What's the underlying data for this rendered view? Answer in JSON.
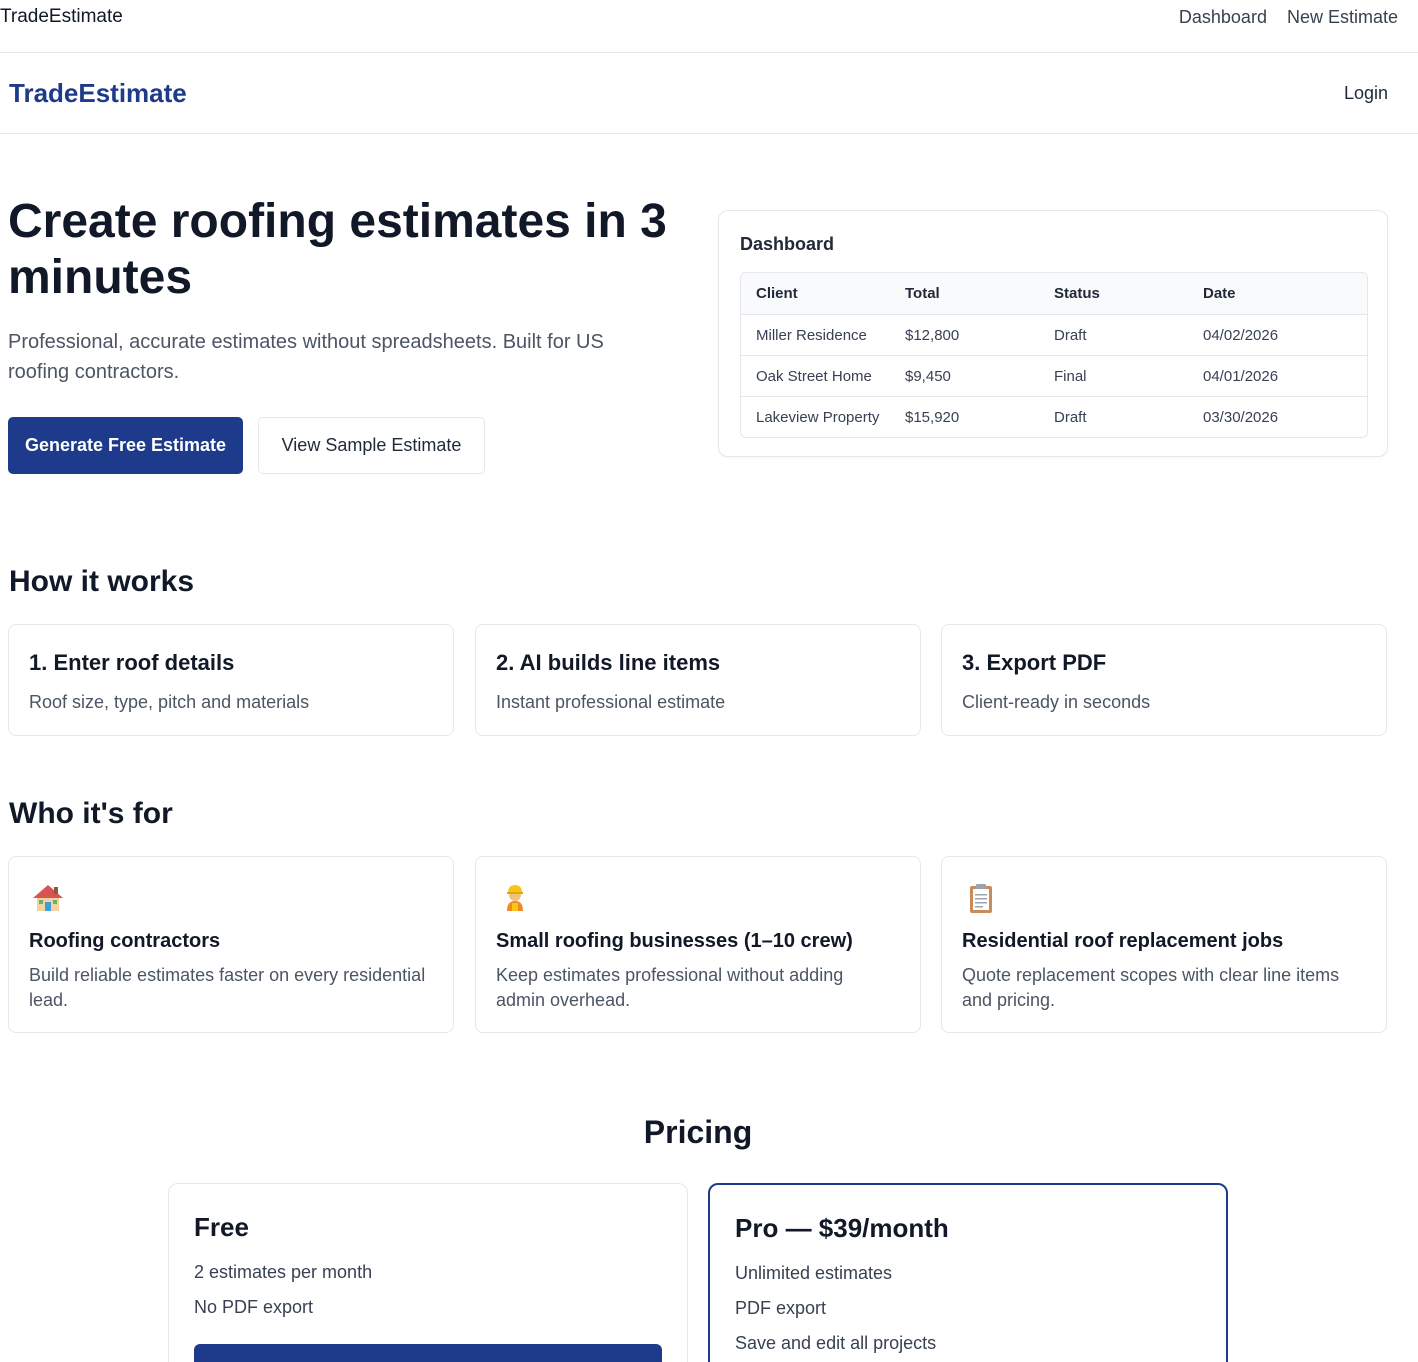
{
  "appbar": {
    "brand": "TradeEstimate",
    "nav": [
      "Dashboard",
      "New Estimate"
    ]
  },
  "header": {
    "logo": "TradeEstimate",
    "login": "Login"
  },
  "hero": {
    "title": "Create roofing estimates in 3 minutes",
    "subtitle": "Professional, accurate estimates without spreadsheets. Built for US roofing contractors.",
    "primary_button": "Generate Free Estimate",
    "secondary_button": "View Sample Estimate"
  },
  "dashboard_preview": {
    "title": "Dashboard",
    "columns": [
      "Client",
      "Total",
      "Status",
      "Date"
    ],
    "rows": [
      [
        "Miller Residence",
        "$12,800",
        "Draft",
        "04/02/2026"
      ],
      [
        "Oak Street Home",
        "$9,450",
        "Final",
        "04/01/2026"
      ],
      [
        "Lakeview Property",
        "$15,920",
        "Draft",
        "03/30/2026"
      ]
    ]
  },
  "how_it_works": {
    "title": "How it works",
    "steps": [
      {
        "title": "1. Enter roof details",
        "text": "Roof size, type, pitch and materials"
      },
      {
        "title": "2. AI builds line items",
        "text": "Instant professional estimate"
      },
      {
        "title": "3. Export PDF",
        "text": "Client-ready in seconds"
      }
    ]
  },
  "who_its_for": {
    "title": "Who it's for",
    "items": [
      {
        "icon": "house-icon",
        "title": "Roofing contractors",
        "text": "Build reliable estimates faster on every residential lead."
      },
      {
        "icon": "construction-worker-icon",
        "title": "Small roofing businesses (1–10 crew)",
        "text": "Keep estimates professional without adding admin overhead."
      },
      {
        "icon": "clipboard-icon",
        "title": "Residential roof replacement jobs",
        "text": "Quote replacement scopes with clear line items and pricing."
      }
    ]
  },
  "pricing": {
    "title": "Pricing",
    "plans": [
      {
        "title": "Free",
        "features": [
          "2 estimates per month",
          "No PDF export"
        ]
      },
      {
        "title": "Pro — $39/month",
        "features": [
          "Unlimited estimates",
          "PDF export",
          "Save and edit all projects"
        ]
      }
    ]
  },
  "colors": {
    "brand": "#1e3a8a",
    "border": "#e5e7eb",
    "muted_text": "#4b5563"
  }
}
